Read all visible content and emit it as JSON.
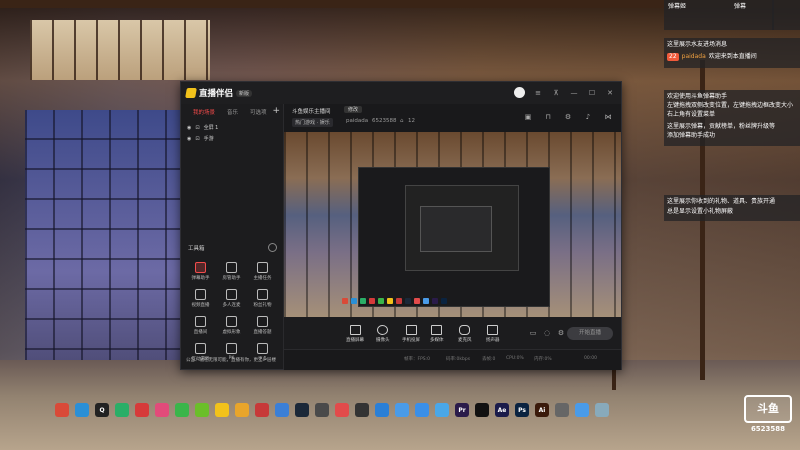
{
  "overlays": {
    "top_right_header": {
      "left": "弹幕姬",
      "right": "弹幕"
    },
    "chat_messages": [
      "这里展示水友进场消息",
      "欢迎来到本直播间"
    ],
    "chat_user": "paidada",
    "chat_badge": "22",
    "note_lines": [
      "欢迎使用斗鱼弹幕助手",
      "左键拖拽双侧改变位置，左键拖拽边框改变大小",
      "右上角有设置菜单",
      "这里展示弹幕，贡献榜单，粉丝牌升级等",
      "添加弹幕助手成功"
    ],
    "gift_note_lines": [
      "这里展示你收到的礼物、道具、贵族开通",
      "总是显示设置小礼物屏蔽"
    ]
  },
  "app": {
    "name": "直播伴侣",
    "version_badge": "新版",
    "sidebar": {
      "tabs": [
        "我的场景",
        "音乐",
        "可选项"
      ],
      "add_label": "+",
      "sources": [
        {
          "label": "全屏 1"
        },
        {
          "label": "手游"
        }
      ],
      "tools_title": "工具箱",
      "tools": [
        {
          "label": "弹幕助手",
          "icon": "danmaku-icon",
          "active": true
        },
        {
          "label": "房管助手",
          "icon": "user-icon",
          "active": false
        },
        {
          "label": "主播任务",
          "icon": "task-icon",
          "active": false
        },
        {
          "label": "视频直播",
          "icon": "video-icon",
          "active": false
        },
        {
          "label": "多人连麦",
          "icon": "download-icon",
          "active": false
        },
        {
          "label": "粉丝礼物",
          "icon": "gift-icon",
          "active": false
        },
        {
          "label": "直播间",
          "icon": "room-icon",
          "active": false
        },
        {
          "label": "虚拟形象",
          "icon": "avatar-icon",
          "active": false
        },
        {
          "label": "直播答题",
          "icon": "calendar-icon",
          "active": false
        },
        {
          "label": "互动游戏",
          "icon": "game-icon",
          "active": false
        },
        {
          "label": "PK",
          "icon": "pk-icon",
          "active": false
        },
        {
          "label": "更多",
          "icon": "more-icon",
          "active": false
        }
      ],
      "notice": "公告：他在无限可能，直播有你，更上一层楼"
    },
    "info": {
      "stream_title": "斗鱼娱乐主播间",
      "edit_label": "修改",
      "category": "热门游戏 · 娱乐",
      "user": "paidada",
      "room_id": "6523588",
      "viewers": "12"
    },
    "toolbar": {
      "buttons": [
        {
          "label": "直播屏幕",
          "icon": "screen-icon"
        },
        {
          "label": "摄像头",
          "icon": "camera-icon"
        },
        {
          "label": "手机投屏",
          "icon": "phone-icon"
        },
        {
          "label": "多媒体",
          "icon": "media-icon"
        },
        {
          "label": "麦克风",
          "icon": "mic-icon"
        },
        {
          "label": "扬声器",
          "icon": "speaker-icon"
        }
      ],
      "start_label": "开始直播"
    },
    "status": [
      "帧率：FPS:0",
      "码率:0kbps",
      "丢帧:0",
      "CPU:0%",
      "内存:0%",
      "00:00"
    ]
  },
  "taskbar": {
    "apps": [
      {
        "name": "chrome-icon",
        "color": "#d94a38",
        "glyph": ""
      },
      {
        "name": "edge-icon",
        "color": "#2a8fd6",
        "glyph": ""
      },
      {
        "name": "qq-icon",
        "color": "#222",
        "glyph": "Q"
      },
      {
        "name": "wechat-icon",
        "color": "#2aae67",
        "glyph": ""
      },
      {
        "name": "netease-music-icon",
        "color": "#d63a3a",
        "glyph": ""
      },
      {
        "name": "game-icon",
        "color": "#e24b7a",
        "glyph": ""
      },
      {
        "name": "video-icon",
        "color": "#3ab54a",
        "glyph": ""
      },
      {
        "name": "iqiyi-icon",
        "color": "#6bbf2a",
        "glyph": ""
      },
      {
        "name": "app-icon",
        "color": "#f2c21b",
        "glyph": ""
      },
      {
        "name": "game2-icon",
        "color": "#e8a52b",
        "glyph": ""
      },
      {
        "name": "music-icon",
        "color": "#c73939",
        "glyph": ""
      },
      {
        "name": "wechat-work-icon",
        "color": "#3b7fd6",
        "glyph": ""
      },
      {
        "name": "steam-icon",
        "color": "#1b2838",
        "glyph": ""
      },
      {
        "name": "game3-icon",
        "color": "#4a4a4a",
        "glyph": ""
      },
      {
        "name": "record-icon",
        "color": "#e24b4b",
        "glyph": ""
      },
      {
        "name": "obs-icon",
        "color": "#333",
        "glyph": ""
      },
      {
        "name": "browser-icon",
        "color": "#2a7fd6",
        "glyph": ""
      },
      {
        "name": "baidu-netdisk-icon",
        "color": "#4a9be8",
        "glyph": ""
      },
      {
        "name": "feishu-icon",
        "color": "#3a8fe8",
        "glyph": ""
      },
      {
        "name": "lark-icon",
        "color": "#4aa7e8",
        "glyph": ""
      },
      {
        "name": "premiere-icon",
        "color": "#2a1b4a",
        "glyph": "Pr"
      },
      {
        "name": "capcut-icon",
        "color": "#111",
        "glyph": ""
      },
      {
        "name": "after-effects-icon",
        "color": "#1a1b4a",
        "glyph": "Ae"
      },
      {
        "name": "photoshop-icon",
        "color": "#0a2340",
        "glyph": "Ps"
      },
      {
        "name": "illustrator-icon",
        "color": "#3a1a0a",
        "glyph": "Ai"
      },
      {
        "name": "other-icon",
        "color": "#666",
        "glyph": ""
      },
      {
        "name": "note-icon",
        "color": "#4a9be8",
        "glyph": ""
      },
      {
        "name": "recycle-bin-icon",
        "color": "#8ab",
        "glyph": ""
      }
    ]
  },
  "watermark": {
    "logo": "斗鱼",
    "sub": "斗鱼",
    "id": "6523588"
  }
}
